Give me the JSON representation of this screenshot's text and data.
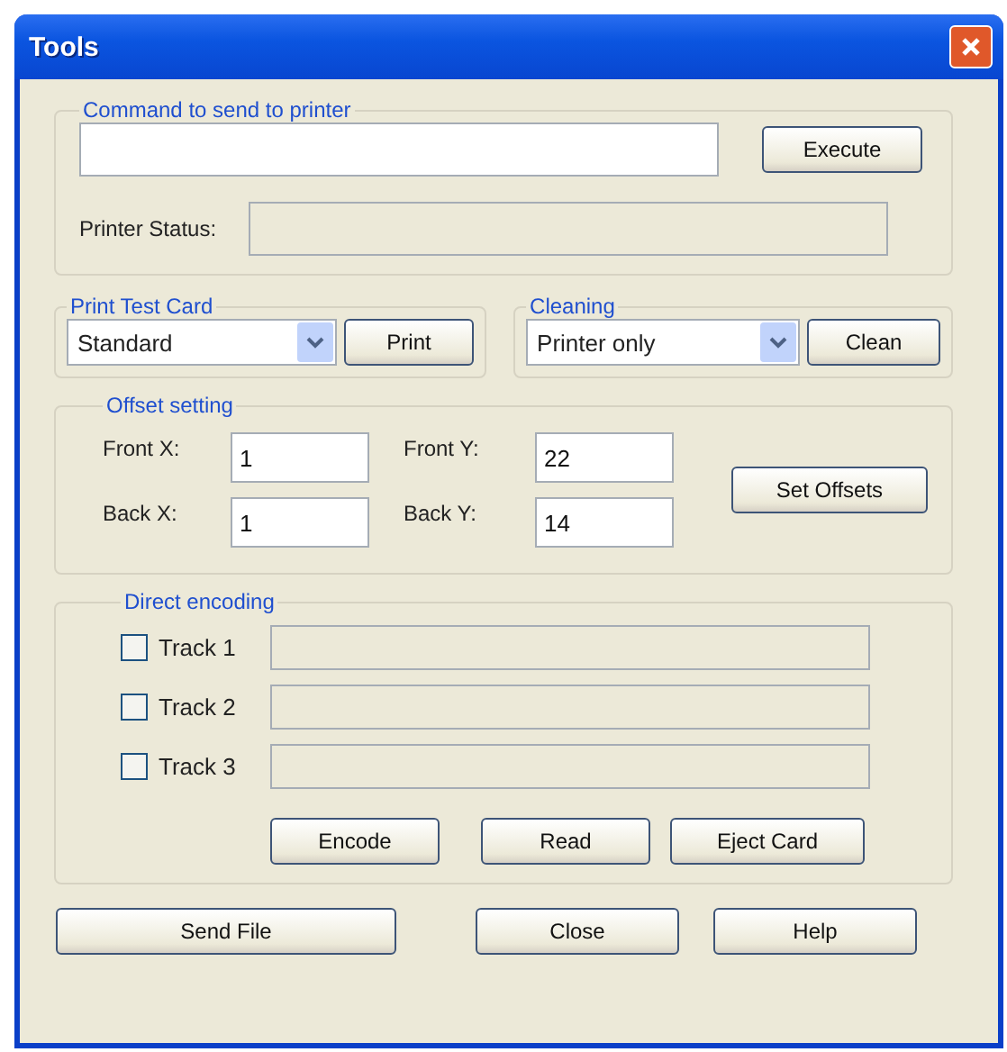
{
  "window": {
    "title": "Tools"
  },
  "command": {
    "legend": "Command to send to printer",
    "button": "Execute",
    "status_label": "Printer Status:",
    "status_disabled": true
  },
  "print_test": {
    "legend": "Print Test Card",
    "selection": "Standard",
    "button": "Print"
  },
  "cleaning": {
    "legend": "Cleaning",
    "selection": "Printer only",
    "button": "Clean"
  },
  "offsets": {
    "legend": "Offset setting",
    "fields": [
      {
        "label": "Front X:",
        "value": "1"
      },
      {
        "label": "Front Y:",
        "value": "22"
      },
      {
        "label": "Back X:",
        "value": "1"
      },
      {
        "label": "Back Y:",
        "value": "14"
      }
    ],
    "button": "Set Offsets"
  },
  "encoding": {
    "legend": "Direct encoding",
    "tracks": [
      {
        "label": "Track 1",
        "checked": false,
        "disabled": true
      },
      {
        "label": "Track 2",
        "checked": false,
        "disabled": true
      },
      {
        "label": "Track 3",
        "checked": false,
        "disabled": true
      }
    ],
    "buttons": [
      "Encode",
      "Read",
      "Eject Card"
    ]
  },
  "buttons": [
    "Send File",
    "Close",
    "Help"
  ]
}
